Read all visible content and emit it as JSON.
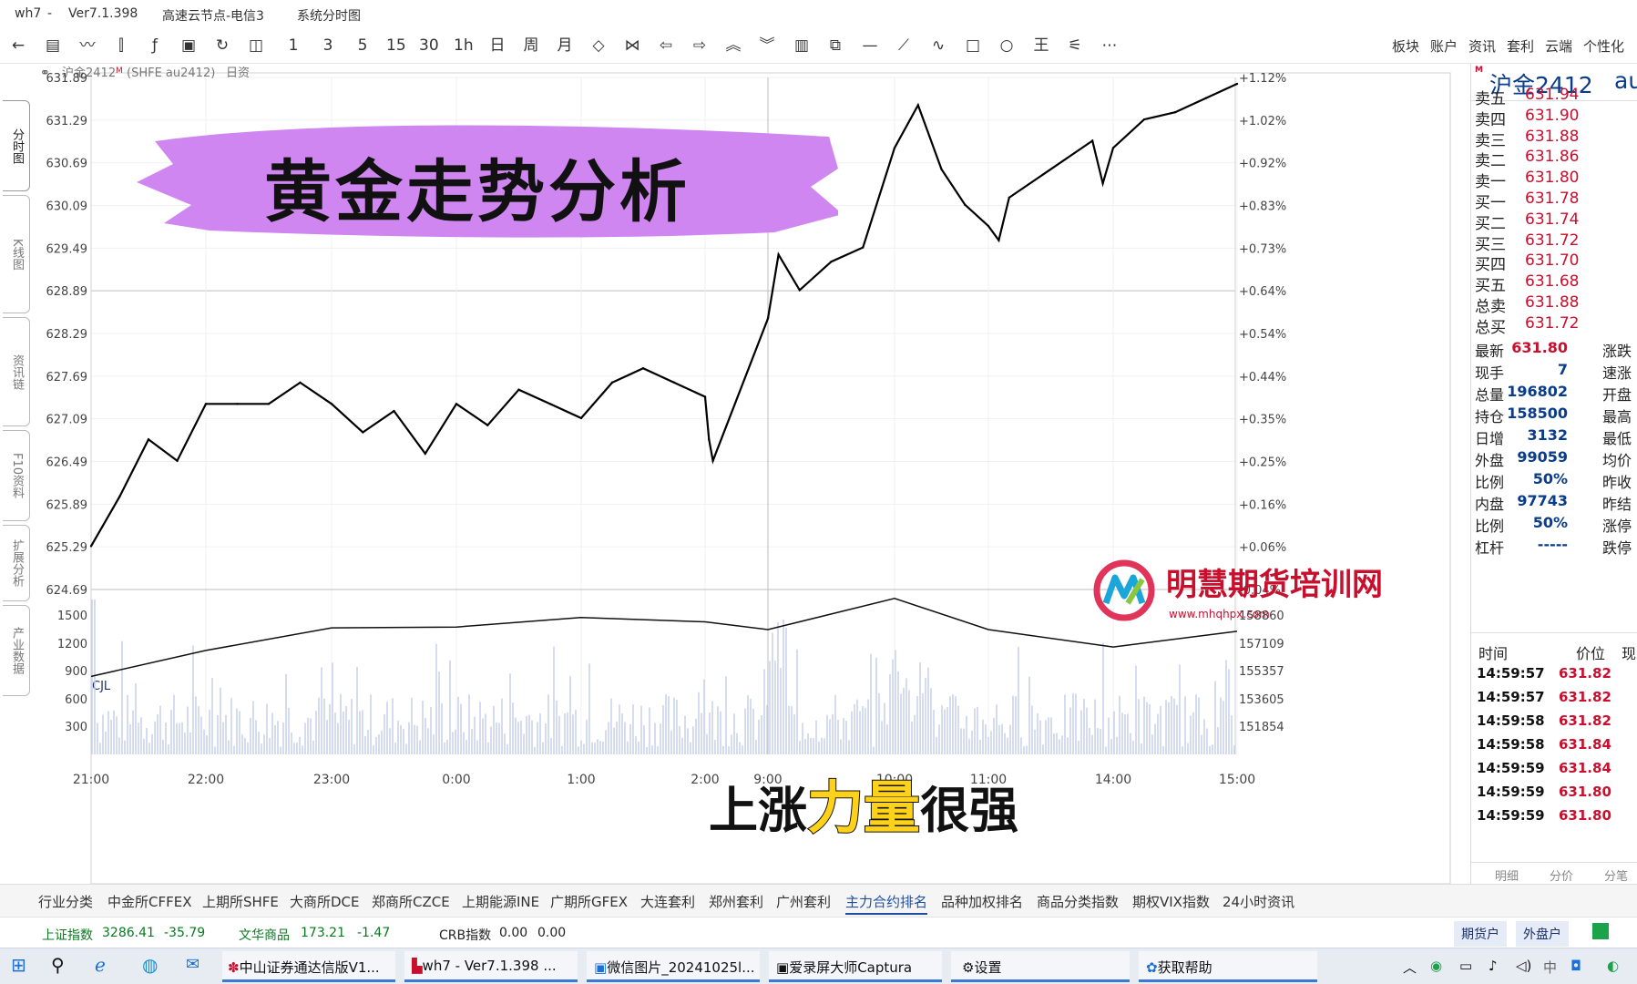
{
  "titlebar": {
    "app": "wh7",
    "version": "Ver7.1.398",
    "server": "高速云节点-电信3",
    "view": "系统分时图",
    "sep": "-"
  },
  "toolbar": {
    "periods": [
      "1",
      "3",
      "5",
      "15",
      "30",
      "1h",
      "日",
      "周",
      "月"
    ],
    "right_menu": [
      "板块",
      "账户",
      "资讯",
      "套利",
      "云端",
      "个性化"
    ]
  },
  "lefttabs": [
    "分时图",
    "K线图",
    "资讯链",
    "F10资料",
    "扩展分析",
    "产业数据"
  ],
  "chart": {
    "contract_label": "沪金2412",
    "contract_mark": "M",
    "contract_code": "(SHFE au2412)",
    "mode": "日资",
    "y_labels": [
      "631.89",
      "631.29",
      "630.69",
      "630.09",
      "629.49",
      "628.89",
      "628.29",
      "627.69",
      "627.09",
      "626.49",
      "625.89",
      "625.29",
      "624.69"
    ],
    "pct_labels": [
      "+1.12%",
      "+1.02%",
      "+0.92%",
      "+0.83%",
      "+0.73%",
      "+0.64%",
      "+0.54%",
      "+0.44%",
      "+0.35%",
      "+0.25%",
      "+0.16%",
      "+0.06%",
      "-0.04%"
    ],
    "vol_title": "CJL",
    "vol_labels": [
      "1500",
      "1200",
      "900",
      "600",
      "300"
    ],
    "oi_labels": [
      "158860",
      "157109",
      "155357",
      "153605",
      "151854"
    ],
    "x_labels": [
      "21:00",
      "22:00",
      "23:00",
      "0:00",
      "1:00",
      "2:00",
      "9:00",
      "10:00",
      "11:00",
      "14:00",
      "15:00"
    ]
  },
  "chart_data": {
    "type": "line",
    "title": "沪金2412",
    "xlabel": "",
    "ylabel": "",
    "ylim": [
      624.69,
      631.89
    ],
    "series": [
      {
        "name": "价格",
        "x": [
          "21:00",
          "21:15",
          "21:30",
          "21:45",
          "22:00",
          "22:15",
          "22:30",
          "22:45",
          "23:00",
          "23:15",
          "23:30",
          "23:45",
          "0:00",
          "0:15",
          "0:30",
          "0:45",
          "1:00",
          "1:15",
          "1:30",
          "1:45",
          "2:00",
          "2:15",
          "2:30",
          "9:00",
          "9:05",
          "9:15",
          "9:30",
          "9:45",
          "10:00",
          "10:15",
          "10:30",
          "10:45",
          "11:00",
          "11:15",
          "11:30",
          "13:30",
          "13:45",
          "14:00",
          "14:15",
          "14:30",
          "14:45",
          "15:00"
        ],
        "values": [
          625.3,
          626.0,
          626.8,
          626.5,
          627.3,
          627.3,
          627.3,
          627.6,
          627.3,
          626.9,
          627.2,
          626.6,
          627.3,
          627.0,
          627.5,
          627.3,
          627.1,
          627.6,
          627.8,
          627.6,
          627.4,
          626.8,
          626.5,
          628.5,
          629.4,
          628.9,
          629.3,
          629.5,
          630.9,
          631.5,
          630.6,
          630.1,
          629.8,
          629.6,
          630.2,
          631.0,
          630.4,
          630.9,
          631.3,
          631.4,
          631.6,
          631.8
        ]
      },
      {
        "name": "持仓",
        "x": [
          "21:00",
          "22:00",
          "23:00",
          "0:00",
          "1:00",
          "2:00",
          "9:00",
          "10:00",
          "11:00",
          "14:00",
          "15:00"
        ],
        "values": [
          155500,
          157000,
          158300,
          158350,
          158900,
          158650,
          158200,
          160000,
          158200,
          157200,
          158100
        ]
      }
    ],
    "volume_range": [
      0,
      1700
    ],
    "grid": true,
    "legend": "none"
  },
  "banner": {
    "text": "黄金走势分析"
  },
  "caption": {
    "before": "上涨",
    "emph": "力量",
    "after": "很强"
  },
  "watermark": {
    "name": "明慧期货培训网",
    "url": "www.mhqhpx.com"
  },
  "quote": {
    "name": "沪金2412",
    "mark": "M",
    "code": "au",
    "book": [
      {
        "label": "卖五",
        "price": "631.94"
      },
      {
        "label": "卖四",
        "price": "631.90"
      },
      {
        "label": "卖三",
        "price": "631.88"
      },
      {
        "label": "卖二",
        "price": "631.86"
      },
      {
        "label": "卖一",
        "price": "631.80"
      },
      {
        "label": "买一",
        "price": "631.78"
      },
      {
        "label": "买二",
        "price": "631.74"
      },
      {
        "label": "买三",
        "price": "631.72"
      },
      {
        "label": "买四",
        "price": "631.70"
      },
      {
        "label": "买五",
        "price": "631.68"
      }
    ],
    "totals": [
      {
        "label": "总卖",
        "price": "631.88"
      },
      {
        "label": "总买",
        "price": "631.72"
      }
    ],
    "metrics": [
      {
        "label": "最新",
        "value": "631.80",
        "label2": "涨跌"
      },
      {
        "label": "现手",
        "value": "7",
        "label2": "速涨"
      },
      {
        "label": "总量",
        "value": "196802",
        "label2": "开盘"
      },
      {
        "label": "持仓",
        "value": "158500",
        "label2": "最高"
      },
      {
        "label": "日增",
        "value": "3132",
        "label2": "最低"
      },
      {
        "label": "外盘",
        "value": "99059",
        "label2": "均价"
      },
      {
        "label": "比例",
        "value": "50%",
        "label2": "昨收"
      },
      {
        "label": "内盘",
        "value": "97743",
        "label2": "昨结"
      },
      {
        "label": "比例",
        "value": "50%",
        "label2": "涨停"
      },
      {
        "label": "杠杆",
        "value": "-----",
        "label2": "跌停"
      }
    ],
    "ticks_header": {
      "time": "时间",
      "price": "价位",
      "vol": "现"
    },
    "ticks": [
      {
        "time": "14:59:57",
        "price": "631.82"
      },
      {
        "time": "14:59:57",
        "price": "631.82"
      },
      {
        "time": "14:59:58",
        "price": "631.82"
      },
      {
        "time": "14:59:58",
        "price": "631.84"
      },
      {
        "time": "14:59:59",
        "price": "631.84"
      },
      {
        "time": "14:59:59",
        "price": "631.80"
      },
      {
        "time": "14:59:59",
        "price": "631.80"
      }
    ],
    "bottom_tabs": [
      "明细",
      "分价",
      "分笔"
    ]
  },
  "bottom_tabs": [
    "行业分类",
    "中金所CFFEX",
    "上期所SHFE",
    "大商所DCE",
    "郑商所CZCE",
    "上期能源INE",
    "广期所GFEX",
    "大连套利",
    "郑州套利",
    "广州套利",
    "主力合约排名",
    "品种加权排名",
    "商品分类指数",
    "期权VIX指数",
    "24小时资讯"
  ],
  "indices": [
    {
      "name": "上证指数",
      "value": "3286.41",
      "change": "-35.79"
    },
    {
      "name": "文华商品",
      "value": "173.21",
      "change": "-1.47"
    },
    {
      "name": "CRB指数",
      "value": "0.00",
      "change": "0.00"
    }
  ],
  "status_buttons": [
    "期货户",
    "外盘户"
  ],
  "taskbar": [
    "中山证券通达信版V1...",
    "wh7 - Ver7.1.398 ...",
    "微信图片_20241025l...",
    "爱录屏大师Captura",
    "设置",
    "获取帮助"
  ],
  "colors": {
    "price_line": "#000000",
    "up": "#c8102e",
    "down": "#0a7a20",
    "accent": "#1f4fa3",
    "banner": "#cf86f0",
    "volume": "#c7d0ea"
  }
}
